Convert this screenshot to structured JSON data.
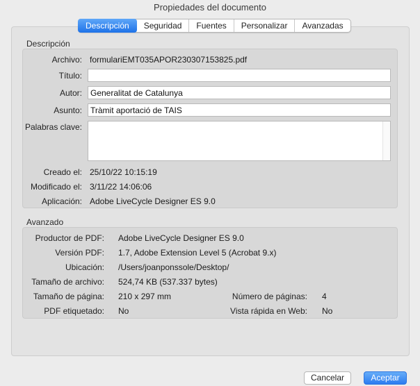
{
  "window": {
    "title": "Propiedades del documento"
  },
  "tabs": [
    {
      "label": "Descripción",
      "active": true
    },
    {
      "label": "Seguridad",
      "active": false
    },
    {
      "label": "Fuentes",
      "active": false
    },
    {
      "label": "Personalizar",
      "active": false
    },
    {
      "label": "Avanzadas",
      "active": false
    }
  ],
  "description": {
    "section_title": "Descripción",
    "archivo_label": "Archivo:",
    "archivo_value": "formulariEMT035APOR230307153825.pdf",
    "titulo_label": "Título:",
    "titulo_value": "",
    "autor_label": "Autor:",
    "autor_value": "Generalitat de Catalunya",
    "asunto_label": "Asunto:",
    "asunto_value": "Tràmit aportació de TAIS",
    "palabras_label": "Palabras clave:",
    "palabras_value": "",
    "creado_label": "Creado el:",
    "creado_value": "25/10/22 10:15:19",
    "modificado_label": "Modificado el:",
    "modificado_value": "3/11/22 14:06:06",
    "aplicacion_label": "Aplicación:",
    "aplicacion_value": "Adobe LiveCycle Designer ES 9.0"
  },
  "advanced": {
    "section_title": "Avanzado",
    "productor_label": "Productor de PDF:",
    "productor_value": "Adobe LiveCycle Designer ES 9.0",
    "version_label": "Versión PDF:",
    "version_value": "1.7, Adobe Extension Level 5 (Acrobat 9.x)",
    "ubicacion_label": "Ubicación:",
    "ubicacion_value": "/Users/joanponssole/Desktop/",
    "tamano_archivo_label": "Tamaño de archivo:",
    "tamano_archivo_value": "524,74 KB (537.337 bytes)",
    "tamano_pagina_label": "Tamaño de página:",
    "tamano_pagina_value": "210 x 297 mm",
    "num_paginas_label": "Número de páginas:",
    "num_paginas_value": "4",
    "etiquetado_label": "PDF etiquetado:",
    "etiquetado_value": "No",
    "vista_rapida_label": "Vista rápida en Web:",
    "vista_rapida_value": "No"
  },
  "buttons": {
    "cancel_label": "Cancelar",
    "ok_label": "Aceptar"
  },
  "colors": {
    "accent": "#2c7cf0",
    "panel": "#e3e3e3",
    "window": "#ececec"
  }
}
